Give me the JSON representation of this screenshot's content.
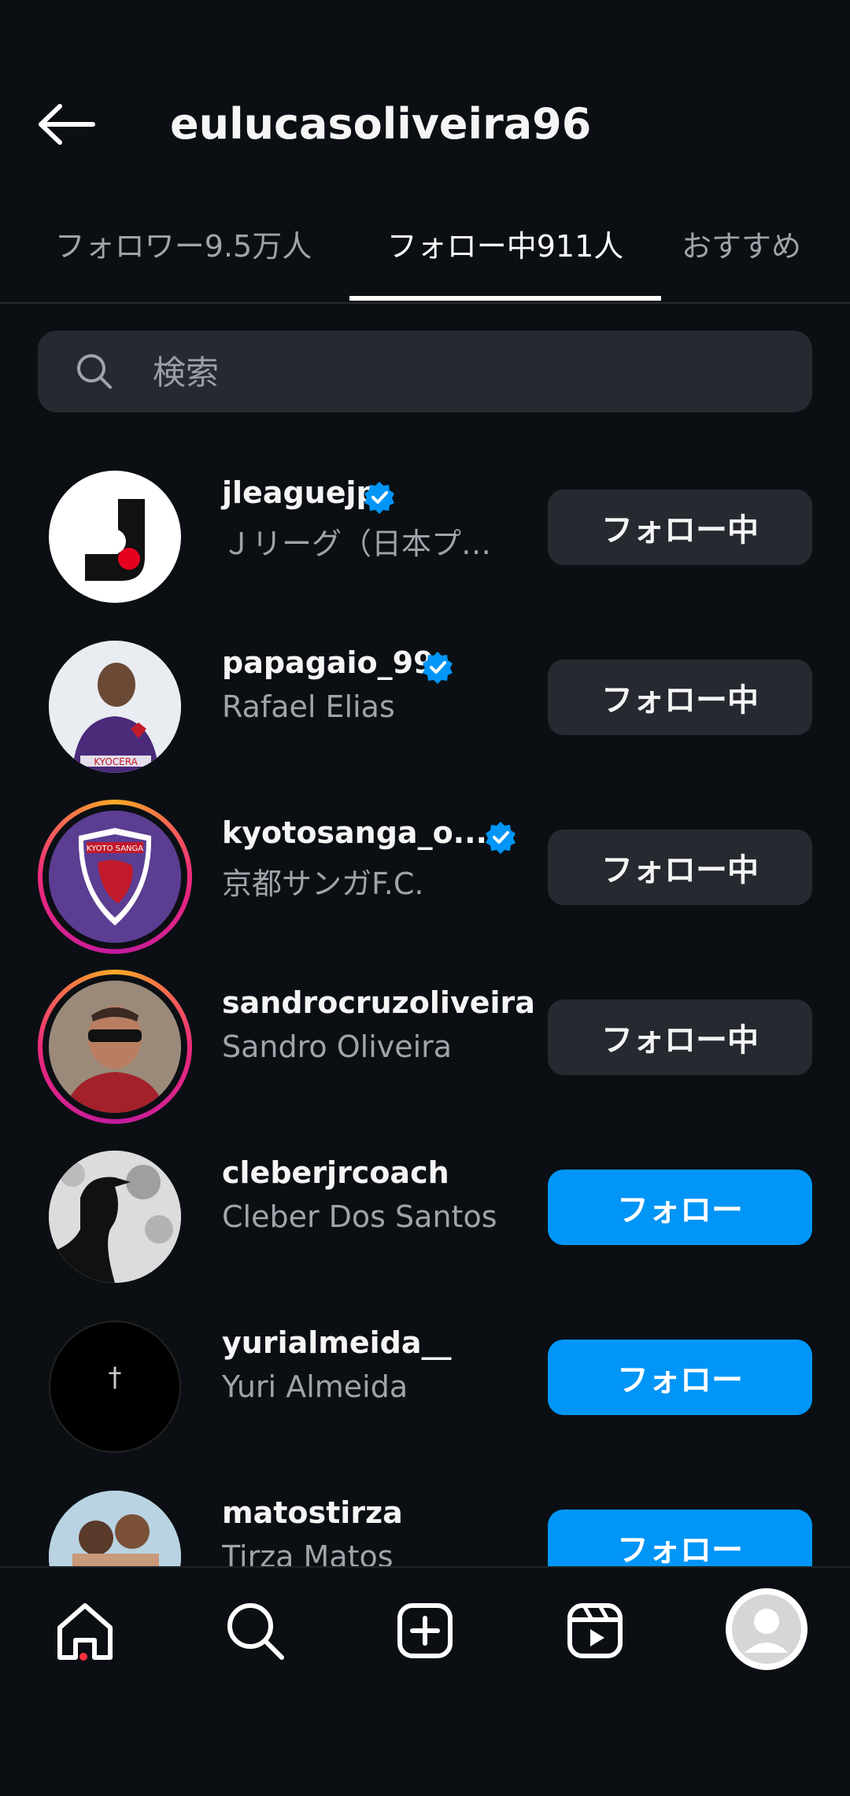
{
  "header": {
    "title": "eulucasoliveira96"
  },
  "tabs": [
    {
      "label": "フォロワー9.5万人",
      "active": false
    },
    {
      "label": "フォロー中911人",
      "active": true
    },
    {
      "label": "おすすめ",
      "active": false
    }
  ],
  "search": {
    "placeholder": "検索"
  },
  "users": [
    {
      "username": "jleaguejp",
      "display_name": "Ｊリーグ（日本プ…",
      "verified": true,
      "story_ring": false,
      "button": "フォロー中"
    },
    {
      "username": "papagaio_99",
      "display_name": "Rafael Elias",
      "verified": true,
      "story_ring": false,
      "button": "フォロー中"
    },
    {
      "username": "kyotosanga_o...",
      "display_name": "京都サンガF.C.",
      "verified": true,
      "story_ring": true,
      "button": "フォロー中"
    },
    {
      "username": "sandrocruzoliveira",
      "display_name": "Sandro Oliveira",
      "verified": false,
      "story_ring": true,
      "button": "フォロー中"
    },
    {
      "username": "cleberjrcoach",
      "display_name": "Cleber Dos Santos",
      "verified": false,
      "story_ring": false,
      "button": "フォロー"
    },
    {
      "username": "yurialmeida__",
      "display_name": "Yuri Almeida",
      "verified": false,
      "story_ring": false,
      "button": "フォロー"
    },
    {
      "username": "matostirza",
      "display_name": "Tirza Matos",
      "verified": false,
      "story_ring": false,
      "button": "フォロー"
    }
  ],
  "avatars": {
    "kyoto_badge_text": "KYOTO SANGA",
    "jersey_text": "KYOCERA",
    "cross_glyph": "†"
  },
  "colors": {
    "background": "#0b0f14",
    "follow_button": "#0095f6",
    "following_button": "#262a30",
    "verified_badge": "#0095f6",
    "notification_dot": "#ff3040"
  },
  "bottom_nav": [
    "home-icon",
    "search-icon",
    "create-icon",
    "reels-icon",
    "profile-avatar"
  ]
}
